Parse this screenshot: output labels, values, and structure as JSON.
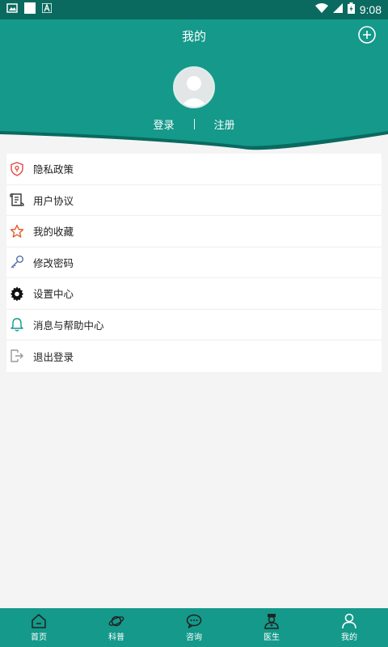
{
  "status_bar": {
    "time": "9:08",
    "icons": [
      "image-icon",
      "square-icon",
      "a-icon",
      "wifi-icon",
      "signal-icon",
      "battery-icon"
    ]
  },
  "header": {
    "title": "我的",
    "login_label": "登录",
    "register_label": "注册",
    "colors": {
      "primary": "#14998a",
      "dark": "#0a6a60"
    }
  },
  "menu": {
    "items": [
      {
        "label": "隐私政策",
        "icon": "shield-icon",
        "color": "#e2473f"
      },
      {
        "label": "用户协议",
        "icon": "document-icon",
        "color": "#333333"
      },
      {
        "label": "我的收藏",
        "icon": "star-icon",
        "color": "#e85a2a"
      },
      {
        "label": "修改密码",
        "icon": "key-icon",
        "color": "#4f6fa8"
      },
      {
        "label": "设置中心",
        "icon": "gear-icon",
        "color": "#111111"
      },
      {
        "label": "消息与帮助中心",
        "icon": "bell-icon",
        "color": "#14998a"
      },
      {
        "label": "退出登录",
        "icon": "logout-icon",
        "color": "#999999"
      }
    ]
  },
  "bottom_nav": {
    "items": [
      {
        "label": "首页",
        "icon": "home-icon"
      },
      {
        "label": "科普",
        "icon": "planet-icon"
      },
      {
        "label": "咨询",
        "icon": "chat-icon"
      },
      {
        "label": "医生",
        "icon": "doctor-icon"
      },
      {
        "label": "我的",
        "icon": "user-icon"
      }
    ]
  }
}
